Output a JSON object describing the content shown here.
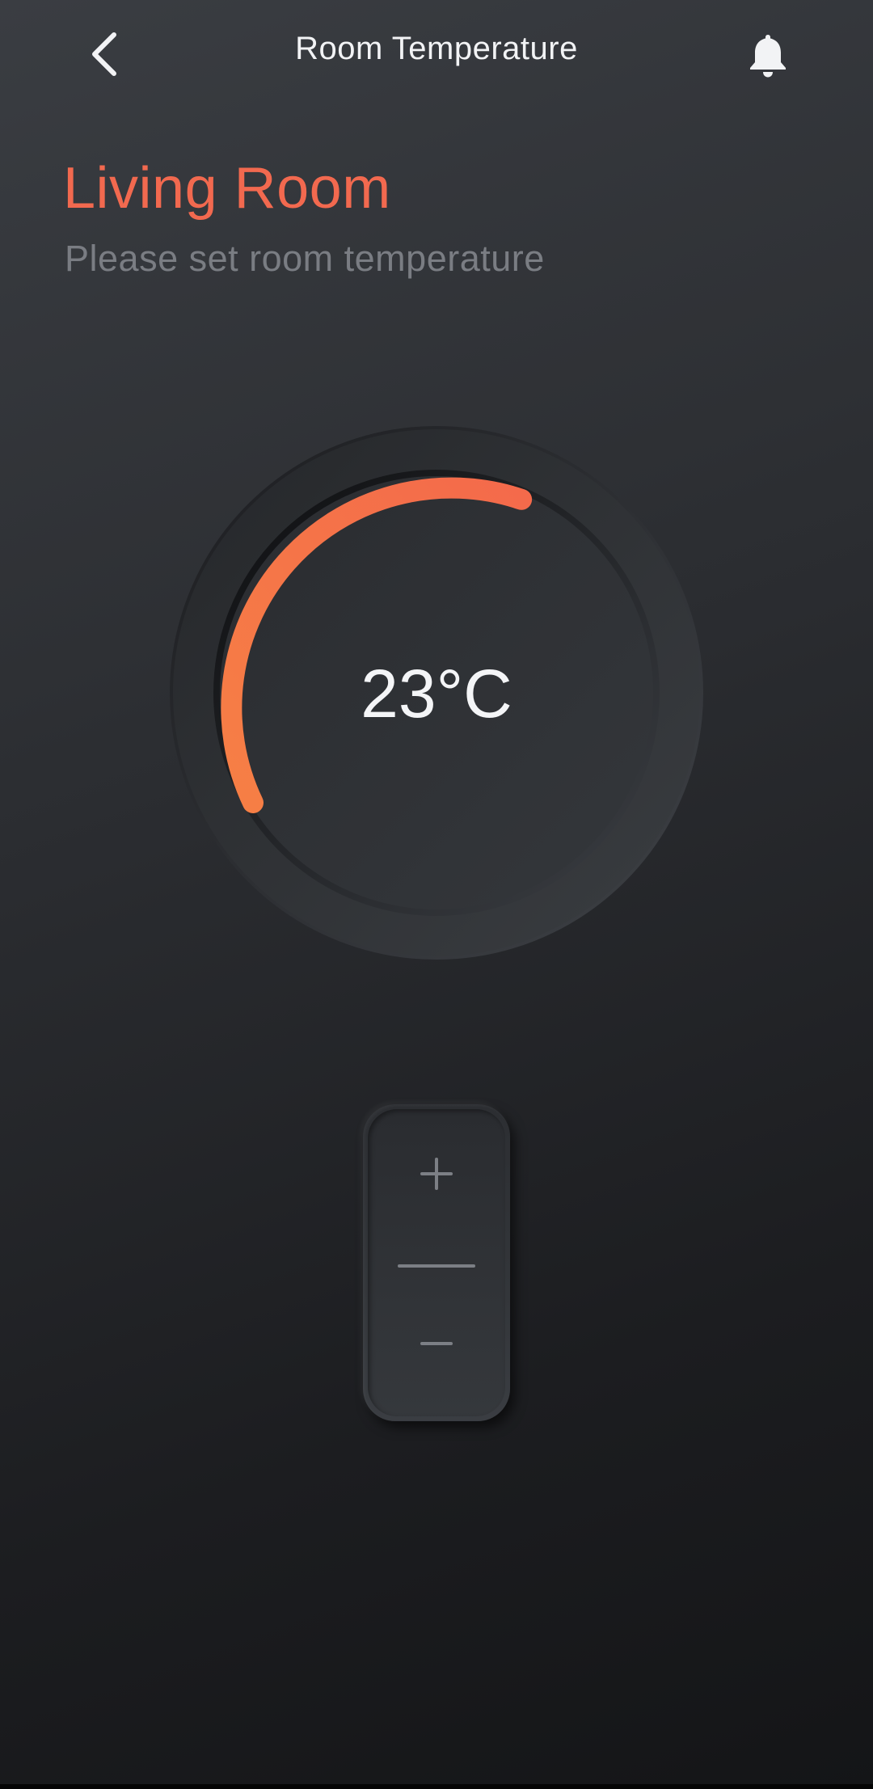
{
  "header": {
    "title": "Room Temperature",
    "back_icon": "chevron-left-icon",
    "notification_icon": "bell-icon"
  },
  "room": {
    "name": "Living Room",
    "subtitle": "Please set room temperature"
  },
  "dial": {
    "value": "23°C",
    "progress_fraction": 0.38,
    "accent_color": "#f46b4a",
    "accent_color_end": "#f57f45"
  },
  "stepper": {
    "increment_icon": "plus-icon",
    "decrement_icon": "minus-icon"
  },
  "colors": {
    "accent": "#f2694f",
    "text_primary": "#f2f3f5",
    "text_secondary": "#7a7d83"
  }
}
